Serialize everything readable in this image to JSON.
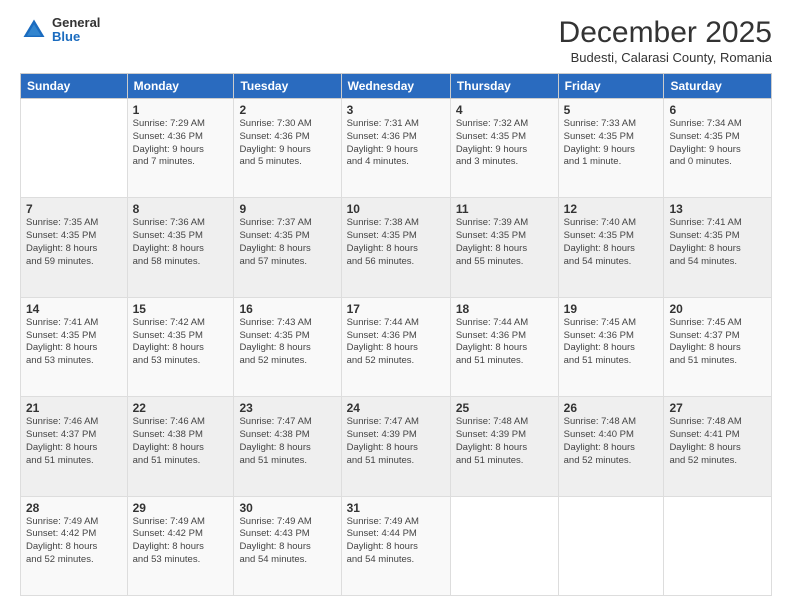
{
  "header": {
    "logo": {
      "line1": "General",
      "line2": "Blue"
    },
    "title": "December 2025",
    "location": "Budesti, Calarasi County, Romania"
  },
  "calendar": {
    "days_of_week": [
      "Sunday",
      "Monday",
      "Tuesday",
      "Wednesday",
      "Thursday",
      "Friday",
      "Saturday"
    ],
    "weeks": [
      [
        {
          "day": "",
          "info": ""
        },
        {
          "day": "1",
          "info": "Sunrise: 7:29 AM\nSunset: 4:36 PM\nDaylight: 9 hours\nand 7 minutes."
        },
        {
          "day": "2",
          "info": "Sunrise: 7:30 AM\nSunset: 4:36 PM\nDaylight: 9 hours\nand 5 minutes."
        },
        {
          "day": "3",
          "info": "Sunrise: 7:31 AM\nSunset: 4:36 PM\nDaylight: 9 hours\nand 4 minutes."
        },
        {
          "day": "4",
          "info": "Sunrise: 7:32 AM\nSunset: 4:35 PM\nDaylight: 9 hours\nand 3 minutes."
        },
        {
          "day": "5",
          "info": "Sunrise: 7:33 AM\nSunset: 4:35 PM\nDaylight: 9 hours\nand 1 minute."
        },
        {
          "day": "6",
          "info": "Sunrise: 7:34 AM\nSunset: 4:35 PM\nDaylight: 9 hours\nand 0 minutes."
        }
      ],
      [
        {
          "day": "7",
          "info": "Sunrise: 7:35 AM\nSunset: 4:35 PM\nDaylight: 8 hours\nand 59 minutes."
        },
        {
          "day": "8",
          "info": "Sunrise: 7:36 AM\nSunset: 4:35 PM\nDaylight: 8 hours\nand 58 minutes."
        },
        {
          "day": "9",
          "info": "Sunrise: 7:37 AM\nSunset: 4:35 PM\nDaylight: 8 hours\nand 57 minutes."
        },
        {
          "day": "10",
          "info": "Sunrise: 7:38 AM\nSunset: 4:35 PM\nDaylight: 8 hours\nand 56 minutes."
        },
        {
          "day": "11",
          "info": "Sunrise: 7:39 AM\nSunset: 4:35 PM\nDaylight: 8 hours\nand 55 minutes."
        },
        {
          "day": "12",
          "info": "Sunrise: 7:40 AM\nSunset: 4:35 PM\nDaylight: 8 hours\nand 54 minutes."
        },
        {
          "day": "13",
          "info": "Sunrise: 7:41 AM\nSunset: 4:35 PM\nDaylight: 8 hours\nand 54 minutes."
        }
      ],
      [
        {
          "day": "14",
          "info": "Sunrise: 7:41 AM\nSunset: 4:35 PM\nDaylight: 8 hours\nand 53 minutes."
        },
        {
          "day": "15",
          "info": "Sunrise: 7:42 AM\nSunset: 4:35 PM\nDaylight: 8 hours\nand 53 minutes."
        },
        {
          "day": "16",
          "info": "Sunrise: 7:43 AM\nSunset: 4:35 PM\nDaylight: 8 hours\nand 52 minutes."
        },
        {
          "day": "17",
          "info": "Sunrise: 7:44 AM\nSunset: 4:36 PM\nDaylight: 8 hours\nand 52 minutes."
        },
        {
          "day": "18",
          "info": "Sunrise: 7:44 AM\nSunset: 4:36 PM\nDaylight: 8 hours\nand 51 minutes."
        },
        {
          "day": "19",
          "info": "Sunrise: 7:45 AM\nSunset: 4:36 PM\nDaylight: 8 hours\nand 51 minutes."
        },
        {
          "day": "20",
          "info": "Sunrise: 7:45 AM\nSunset: 4:37 PM\nDaylight: 8 hours\nand 51 minutes."
        }
      ],
      [
        {
          "day": "21",
          "info": "Sunrise: 7:46 AM\nSunset: 4:37 PM\nDaylight: 8 hours\nand 51 minutes."
        },
        {
          "day": "22",
          "info": "Sunrise: 7:46 AM\nSunset: 4:38 PM\nDaylight: 8 hours\nand 51 minutes."
        },
        {
          "day": "23",
          "info": "Sunrise: 7:47 AM\nSunset: 4:38 PM\nDaylight: 8 hours\nand 51 minutes."
        },
        {
          "day": "24",
          "info": "Sunrise: 7:47 AM\nSunset: 4:39 PM\nDaylight: 8 hours\nand 51 minutes."
        },
        {
          "day": "25",
          "info": "Sunrise: 7:48 AM\nSunset: 4:39 PM\nDaylight: 8 hours\nand 51 minutes."
        },
        {
          "day": "26",
          "info": "Sunrise: 7:48 AM\nSunset: 4:40 PM\nDaylight: 8 hours\nand 52 minutes."
        },
        {
          "day": "27",
          "info": "Sunrise: 7:48 AM\nSunset: 4:41 PM\nDaylight: 8 hours\nand 52 minutes."
        }
      ],
      [
        {
          "day": "28",
          "info": "Sunrise: 7:49 AM\nSunset: 4:42 PM\nDaylight: 8 hours\nand 52 minutes."
        },
        {
          "day": "29",
          "info": "Sunrise: 7:49 AM\nSunset: 4:42 PM\nDaylight: 8 hours\nand 53 minutes."
        },
        {
          "day": "30",
          "info": "Sunrise: 7:49 AM\nSunset: 4:43 PM\nDaylight: 8 hours\nand 54 minutes."
        },
        {
          "day": "31",
          "info": "Sunrise: 7:49 AM\nSunset: 4:44 PM\nDaylight: 8 hours\nand 54 minutes."
        },
        {
          "day": "",
          "info": ""
        },
        {
          "day": "",
          "info": ""
        },
        {
          "day": "",
          "info": ""
        }
      ]
    ]
  }
}
